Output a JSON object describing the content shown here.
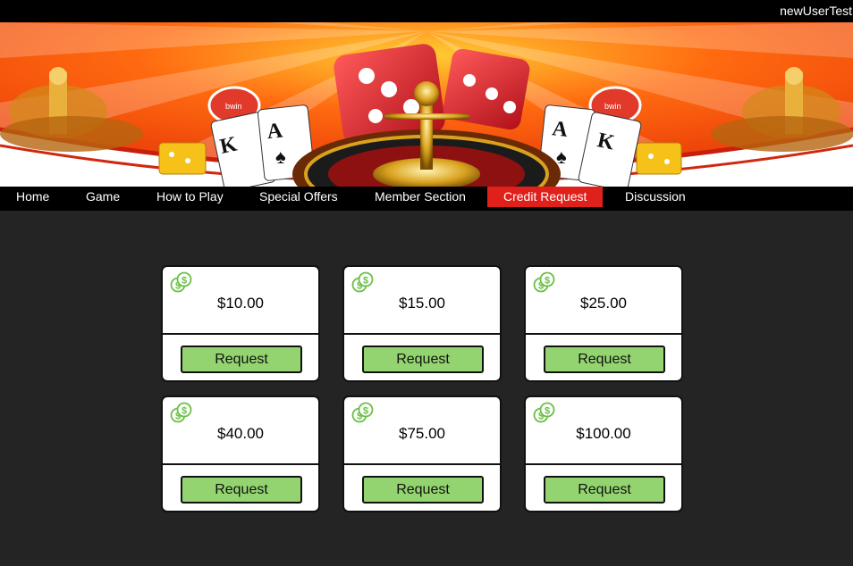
{
  "header": {
    "username": "newUserTest"
  },
  "nav": {
    "items": [
      {
        "label": "Home"
      },
      {
        "label": "Game"
      },
      {
        "label": "How to Play"
      },
      {
        "label": "Special Offers"
      },
      {
        "label": "Member Section"
      },
      {
        "label": "Credit Request",
        "active": true
      },
      {
        "label": "Discussion"
      }
    ]
  },
  "credits": {
    "button_label": "Request",
    "cards": [
      {
        "amount": "$10.00"
      },
      {
        "amount": "$15.00"
      },
      {
        "amount": "$25.00"
      },
      {
        "amount": "$40.00"
      },
      {
        "amount": "$75.00"
      },
      {
        "amount": "$100.00"
      }
    ]
  },
  "banner": {
    "card_letters": [
      "K",
      "A",
      "A",
      "K"
    ],
    "chip_labels": [
      "bwin",
      "bwin"
    ]
  },
  "colors": {
    "nav_active": "#e0201a",
    "button_fill": "#93d470",
    "coin_icon": "#6cbf47",
    "background": "#242424"
  },
  "icons": {
    "coin": "dollar-coins-icon",
    "dice": "dice-icon",
    "roulette": "roulette-wheel-icon"
  }
}
